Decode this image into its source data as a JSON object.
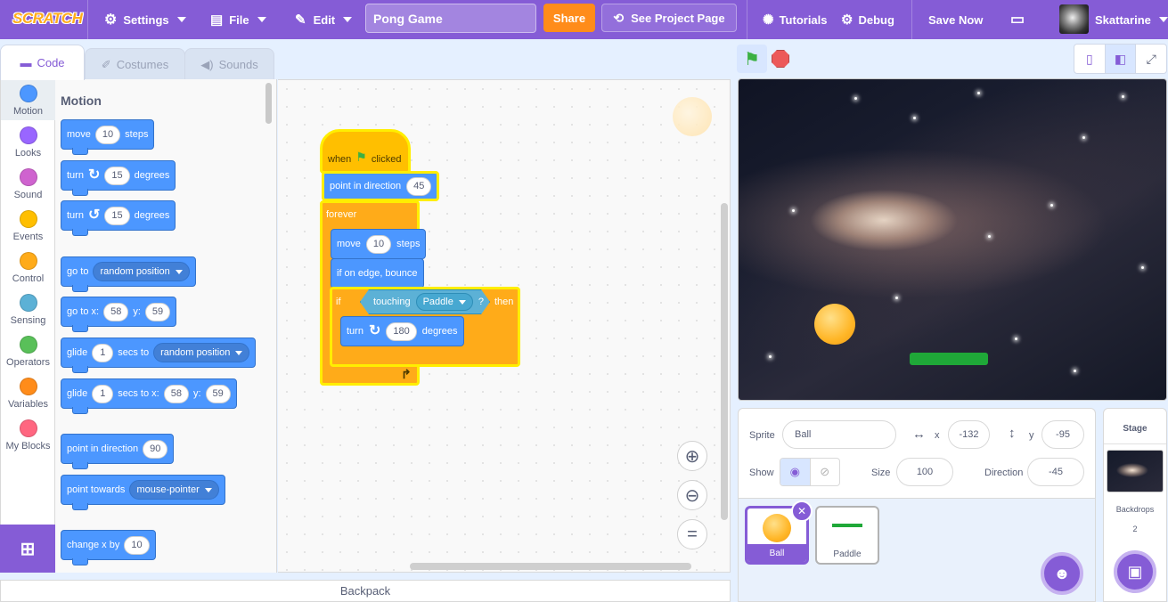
{
  "menubar": {
    "logo": "SCRATCH",
    "settings": "Settings",
    "file": "File",
    "edit": "Edit",
    "project_title": "Pong Game",
    "share": "Share",
    "see_project_page": "See Project Page",
    "tutorials": "Tutorials",
    "debug": "Debug",
    "save_now": "Save Now",
    "username": "Skattarine"
  },
  "tabs": {
    "code": "Code",
    "costumes": "Costumes",
    "sounds": "Sounds"
  },
  "categories": [
    {
      "label": "Motion",
      "color": "#4c97ff"
    },
    {
      "label": "Looks",
      "color": "#9966ff"
    },
    {
      "label": "Sound",
      "color": "#cf63cf"
    },
    {
      "label": "Events",
      "color": "#ffbf00"
    },
    {
      "label": "Control",
      "color": "#ffab19"
    },
    {
      "label": "Sensing",
      "color": "#5cb1d6"
    },
    {
      "label": "Operators",
      "color": "#59c059"
    },
    {
      "label": "Variables",
      "color": "#ff8c1a"
    },
    {
      "label": "My Blocks",
      "color": "#ff6680"
    }
  ],
  "palette": {
    "title": "Motion",
    "move": {
      "a": "move",
      "v": "10",
      "b": "steps"
    },
    "turn_right": {
      "a": "turn",
      "v": "15",
      "b": "degrees"
    },
    "turn_left": {
      "a": "turn",
      "v": "15",
      "b": "degrees"
    },
    "goto": {
      "a": "go to",
      "d": "random position"
    },
    "goto_xy": {
      "a": "go to x:",
      "x": "58",
      "b": "y:",
      "y": "59"
    },
    "glide": {
      "a": "glide",
      "v": "1",
      "b": "secs to",
      "d": "random position"
    },
    "glide_xy": {
      "a": "glide",
      "v": "1",
      "b": "secs to x:",
      "x": "58",
      "c": "y:",
      "y": "59"
    },
    "point_dir": {
      "a": "point in direction",
      "v": "90"
    },
    "point_towards": {
      "a": "point towards",
      "d": "mouse-pointer"
    },
    "change_x": {
      "a": "change x by",
      "v": "10"
    }
  },
  "script": {
    "when": "when",
    "clicked": "clicked",
    "point_dir": {
      "a": "point in direction",
      "v": "45"
    },
    "forever": "forever",
    "move": {
      "a": "move",
      "v": "10",
      "b": "steps"
    },
    "bounce": "if on edge, bounce",
    "if": "if",
    "touching": "touching",
    "touching_target": "Paddle",
    "question": "?",
    "then": "then",
    "turn": {
      "a": "turn",
      "v": "180",
      "b": "degrees"
    }
  },
  "backpack": "Backpack",
  "sprite_info": {
    "sprite_label": "Sprite",
    "sprite_name": "Ball",
    "x_label": "x",
    "x": "-132",
    "y_label": "y",
    "y": "-95",
    "show_label": "Show",
    "size_label": "Size",
    "size": "100",
    "direction_label": "Direction",
    "direction": "-45"
  },
  "sprites": [
    {
      "name": "Ball"
    },
    {
      "name": "Paddle"
    }
  ],
  "stage_panel": {
    "title": "Stage",
    "backdrops_label": "Backdrops",
    "backdrops_count": "2"
  },
  "colors": {
    "accent": "#855cd6",
    "motion": "#4c97ff",
    "events": "#ffbf00",
    "control": "#ffab19",
    "sensing": "#5cb1d6",
    "share": "#ff8c1a"
  }
}
